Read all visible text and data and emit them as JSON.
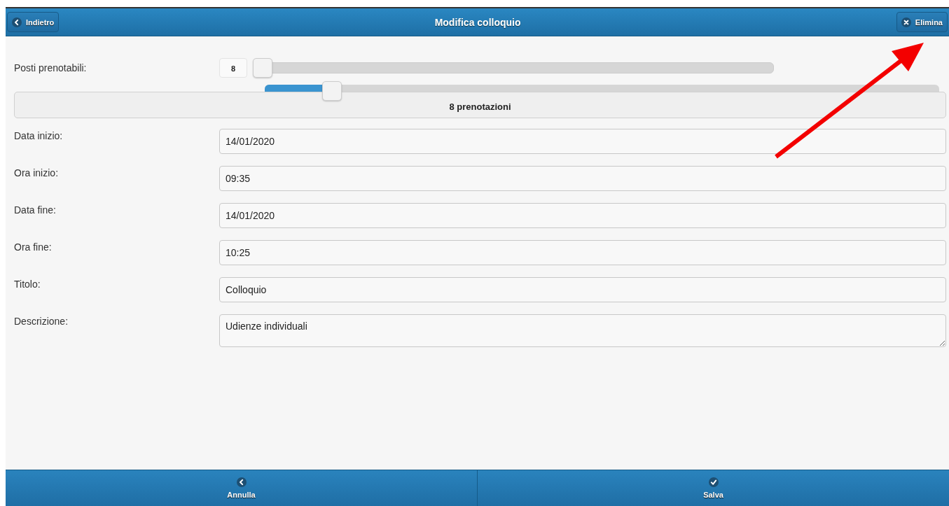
{
  "header": {
    "back_button": "Indietro",
    "title": "Modifica colloquio",
    "delete_button": "Elimina"
  },
  "capacity": {
    "label": "Posti prenotabili:",
    "value": "8",
    "slider": {
      "level": 0
    },
    "booking_slider": {
      "level": 0.1
    },
    "bookings": "8 prenotazioni"
  },
  "fields": [
    {
      "kind": "input",
      "label": "Data inizio:",
      "value": "14/01/2020"
    },
    {
      "kind": "input",
      "label": "Ora inizio:",
      "value": "09:35"
    },
    {
      "kind": "input",
      "label": "Data fine:",
      "value": "14/01/2020"
    },
    {
      "kind": "input",
      "label": "Ora fine:",
      "value": "10:25"
    },
    {
      "kind": "input",
      "label": "Titolo:",
      "value": "Colloquio"
    },
    {
      "kind": "textarea",
      "label": "Descrizione:",
      "value": "Udienze individuali"
    }
  ],
  "footer": [
    {
      "kind": "back",
      "label": "Annulla"
    },
    {
      "kind": "check",
      "label": "Salva"
    }
  ],
  "annotation": {
    "kind": "arrow"
  }
}
